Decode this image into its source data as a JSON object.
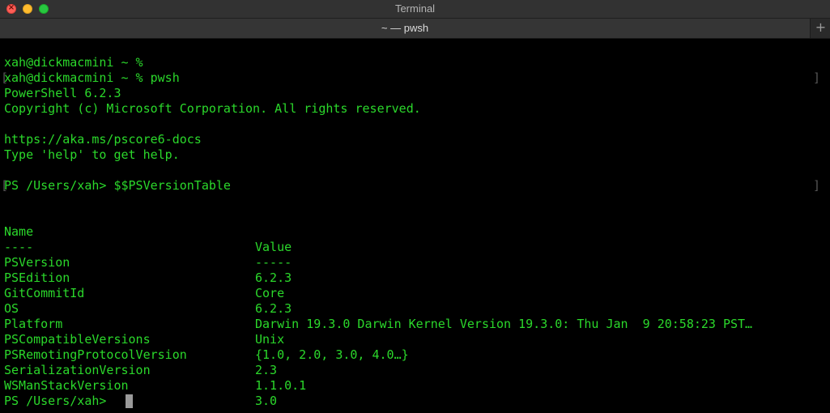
{
  "window": {
    "title": "Terminal"
  },
  "tab": {
    "label": "~ — pwsh",
    "new_tab_glyph": "+"
  },
  "colors": {
    "text": "#2bd82b",
    "background": "#000000",
    "cursor": "#9a9a9a"
  },
  "session": {
    "line1": "xah@dickmacmini ~ %",
    "line2": "xah@dickmacmini ~ % pwsh",
    "banner1": "PowerShell 6.2.3",
    "banner2": "Copyright (c) Microsoft Corporation. All rights reserved.",
    "docs_url": "https://aka.ms/pscore6-docs",
    "help_hint": "Type 'help' to get help.",
    "command_line": "PS /Users/xah> $$PSVersionTable",
    "final_prompt": "PS /Users/xah> "
  },
  "table": {
    "headers": [
      "Name",
      "Value"
    ],
    "separators": [
      "----",
      "-----"
    ],
    "rows": [
      {
        "name": "PSVersion",
        "value": "6.2.3"
      },
      {
        "name": "PSEdition",
        "value": "Core"
      },
      {
        "name": "GitCommitId",
        "value": "6.2.3"
      },
      {
        "name": "OS",
        "value": "Darwin 19.3.0 Darwin Kernel Version 19.3.0: Thu Jan  9 20:58:23 PST…"
      },
      {
        "name": "Platform",
        "value": "Unix"
      },
      {
        "name": "PSCompatibleVersions",
        "value": "{1.0, 2.0, 3.0, 4.0…}"
      },
      {
        "name": "PSRemotingProtocolVersion",
        "value": "2.3"
      },
      {
        "name": "SerializationVersion",
        "value": "1.1.0.1"
      },
      {
        "name": "WSManStackVersion",
        "value": "3.0"
      }
    ]
  }
}
